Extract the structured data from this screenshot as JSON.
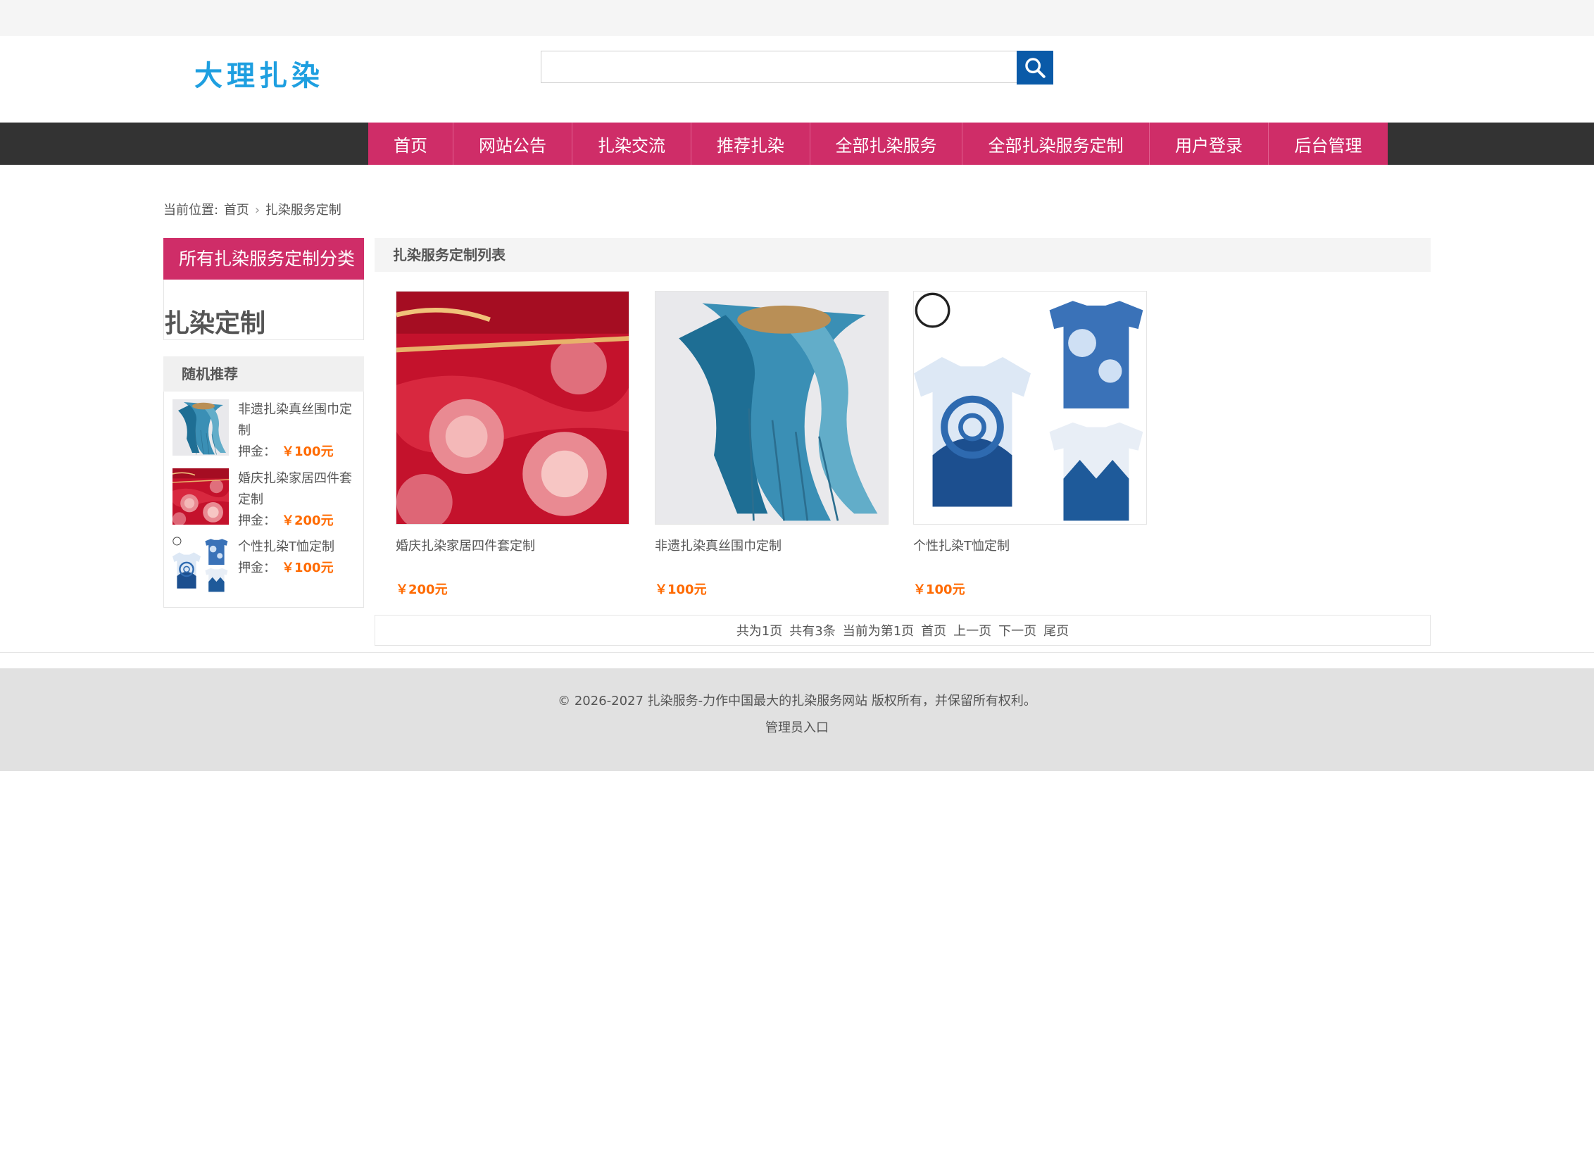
{
  "header": {
    "logo_text": "大理扎染",
    "search": {
      "value": "",
      "placeholder": ""
    }
  },
  "nav": {
    "items": [
      {
        "label": "首页"
      },
      {
        "label": "网站公告"
      },
      {
        "label": "扎染交流"
      },
      {
        "label": "推荐扎染"
      },
      {
        "label": "全部扎染服务"
      },
      {
        "label": "全部扎染服务定制"
      },
      {
        "label": "用户登录"
      },
      {
        "label": "后台管理"
      }
    ]
  },
  "breadcrumb": {
    "prefix": "当前位置:",
    "home": "首页",
    "current": "扎染服务定制"
  },
  "sidebar": {
    "category_title": "所有扎染服务定制分类",
    "category_item": "扎染定制",
    "recommend_title": "随机推荐",
    "recommend": [
      {
        "name": "非遗扎染真丝围巾定制",
        "price_label": "押金：",
        "price": "￥100元",
        "image": "blue-scarf"
      },
      {
        "name": "婚庆扎染家居四件套定制",
        "price_label": "押金：",
        "price": "￥200元",
        "image": "red-bedding"
      },
      {
        "name": "个性扎染T恤定制",
        "price_label": "押金：",
        "price": "￥100元",
        "image": "tie-dye-tshirts"
      }
    ]
  },
  "main": {
    "list_title": "扎染服务定制列表",
    "products": [
      {
        "name": "婚庆扎染家居四件套定制",
        "price": "￥200元",
        "image": "red-bedding"
      },
      {
        "name": "非遗扎染真丝围巾定制",
        "price": "￥100元",
        "image": "blue-scarf"
      },
      {
        "name": "个性扎染T恤定制",
        "price": "￥100元",
        "image": "tie-dye-tshirts"
      }
    ]
  },
  "pagination": {
    "total_pages": "共为1页",
    "total_items": "共有3条",
    "current": "当前为第1页",
    "first": "首页",
    "prev": "上一页",
    "next": "下一页",
    "last": "尾页"
  },
  "footer": {
    "copyright": "© 2026-2027 扎染服务-力作中国最大的扎染服务网站 版权所有，并保留所有权利。",
    "admin_link": "管理员入口"
  },
  "colors": {
    "accent": "#cf2d68",
    "nav_bg": "#333333",
    "search_button": "#0a5aa8",
    "price": "#ff6a00",
    "logo": "#1e9fe0"
  }
}
